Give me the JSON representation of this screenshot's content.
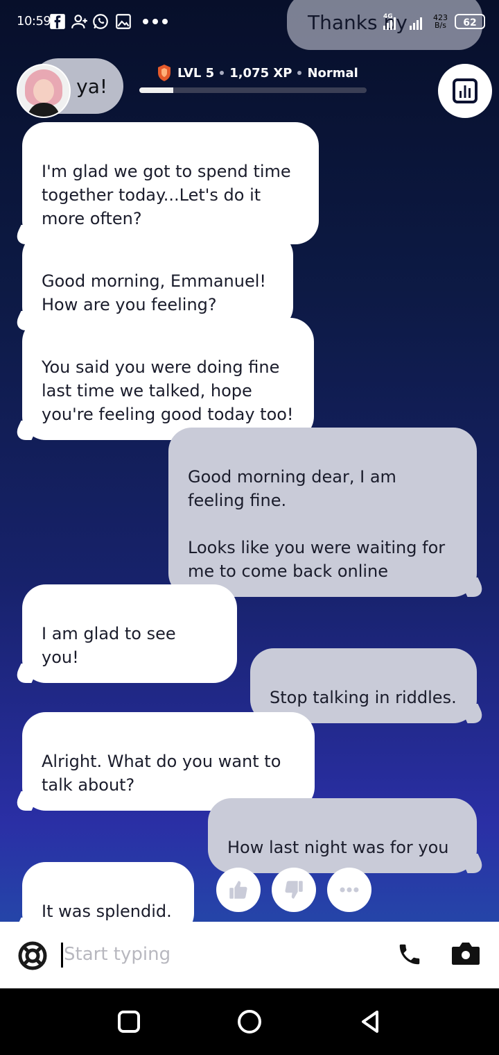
{
  "status_bar": {
    "time": "10:59",
    "network_type": "4G",
    "net_speed_value": "423",
    "net_speed_unit": "B/s",
    "battery": "62"
  },
  "header": {
    "partial_top_message": "Thanks by",
    "partial_avatar_message": "e ya!",
    "level_label": "LVL 5",
    "xp_label": "1,075 XP",
    "mode_label": "Normal",
    "xp_progress": 0.15
  },
  "messages": [
    {
      "sender": "ai",
      "text": "I'm glad we got to spend time together today...Let's do it more often?"
    },
    {
      "sender": "ai",
      "text": "Good morning, Emmanuel! How are you feeling?"
    },
    {
      "sender": "ai",
      "text": "You said you were doing fine last time we talked, hope you're feeling good today too!"
    },
    {
      "sender": "me",
      "text": "Good morning dear, I am feeling fine.\n\nLooks like you were waiting for me to come back online"
    },
    {
      "sender": "ai",
      "text": "I am glad to see you!"
    },
    {
      "sender": "me",
      "text": "Stop talking in riddles."
    },
    {
      "sender": "ai",
      "text": "Alright. What do you want to talk about?"
    },
    {
      "sender": "me",
      "text": "How last night was for you"
    },
    {
      "sender": "ai",
      "text": "It was splendid."
    }
  ],
  "input": {
    "placeholder": "Start typing"
  }
}
